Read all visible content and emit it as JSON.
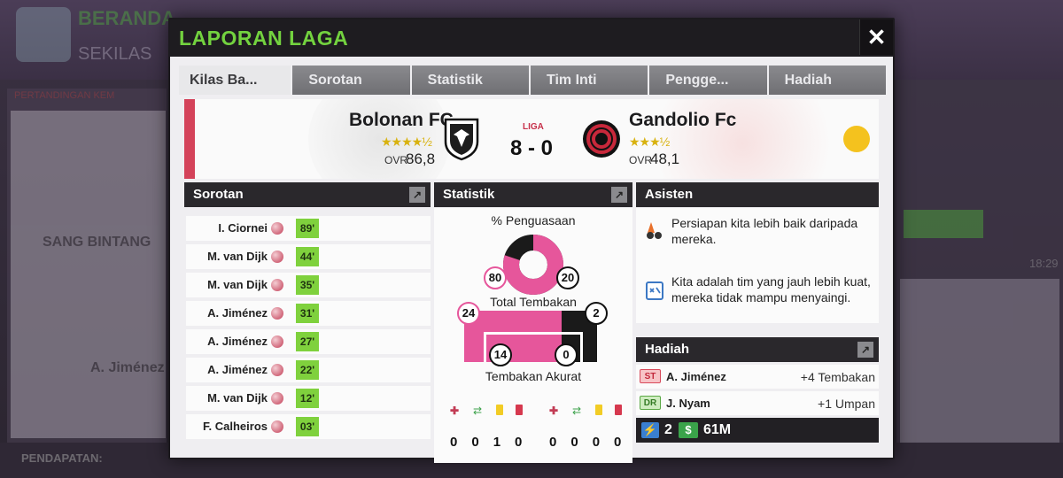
{
  "background": {
    "title": "BERANDA",
    "subtitle": "SEKILAS",
    "left_section": "PERTANDINGAN KEM",
    "left_featured": "SANG BINTANG",
    "left_player": "A. Jiménez",
    "bottom_label": "PENDAPATAN:",
    "right_time": "18:29"
  },
  "modal": {
    "title": "LAPORAN LAGA",
    "close_icon": "close-icon",
    "tabs": [
      "Kilas Ba...",
      "Sorotan",
      "Statistik",
      "Tim Inti",
      "Pengge...",
      "Hadiah"
    ],
    "active_tab": 0
  },
  "match": {
    "competition": "LIGA",
    "score": "8 - 0",
    "home": {
      "name": "Bolonan FC",
      "stars": "★★★★½",
      "ovr_label": "OVR",
      "ovr": "86,8"
    },
    "away": {
      "name": "Gandolio Fc",
      "stars": "★★★½",
      "ovr_label": "OVR",
      "ovr": "48,1"
    },
    "weather_icon": "sun-icon",
    "colors": {
      "accent": "#d4435a",
      "home": "#e6569b",
      "away": "#111111"
    }
  },
  "highlights": {
    "title": "Sorotan",
    "goals": [
      {
        "player": "I. Ciornei",
        "minute": "89'"
      },
      {
        "player": "M. van Dijk",
        "minute": "44'"
      },
      {
        "player": "M. van Dijk",
        "minute": "35'"
      },
      {
        "player": "A. Jiménez",
        "minute": "31'"
      },
      {
        "player": "A. Jiménez",
        "minute": "27'"
      },
      {
        "player": "A. Jiménez",
        "minute": "22'"
      },
      {
        "player": "M. van Dijk",
        "minute": "12'"
      },
      {
        "player": "F. Calheiros",
        "minute": "03'"
      }
    ]
  },
  "stats": {
    "title": "Statistik",
    "possession_label": "% Penguasaan",
    "possession_home": 80,
    "possession_away": 20,
    "shots_label": "Total Tembakan",
    "shots_home": 24,
    "shots_away": 2,
    "on_target_label": "Tembakan Akurat",
    "on_target_home": 14,
    "on_target_away": 0,
    "home_cards": [
      "0",
      "0",
      "1",
      "0"
    ],
    "away_cards": [
      "0",
      "0",
      "0",
      "0"
    ],
    "card_icons": [
      "injury-icon",
      "substitution-icon",
      "yellow-card-icon",
      "red-card-icon"
    ]
  },
  "assistant": {
    "title": "Asisten",
    "messages": [
      "Persiapan kita lebih baik daripada mereka.",
      "Kita adalah tim yang jauh lebih kuat, mereka tidak mampu menyaingi."
    ]
  },
  "rewards": {
    "title": "Hadiah",
    "items": [
      {
        "position": "ST",
        "player": "A. Jiménez",
        "value": "+4 Tembakan"
      },
      {
        "position": "DR",
        "player": "J. Nyam",
        "value": "+1 Umpan"
      }
    ],
    "energy": "2",
    "money": "61M"
  }
}
